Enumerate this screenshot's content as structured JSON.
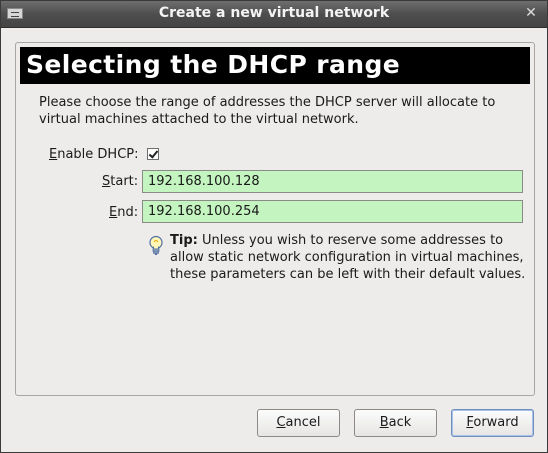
{
  "window": {
    "title": "Create a new virtual network"
  },
  "banner": {
    "title": "Selecting the DHCP range"
  },
  "intro": {
    "text": "Please choose the range of addresses the DHCP server will allocate to virtual machines attached to the virtual network."
  },
  "dhcp": {
    "enable_prefix": "E",
    "enable_rest": "nable DHCP:",
    "enabled": true,
    "start_prefix": "S",
    "start_rest": "tart:",
    "start_value": "192.168.100.128",
    "end_prefix": "E",
    "end_rest": "nd:",
    "end_value": "192.168.100.254"
  },
  "tip": {
    "label": "Tip:",
    "text": " Unless you wish to reserve some addresses to allow static network configuration in virtual machines, these parameters can be left with their default values."
  },
  "buttons": {
    "cancel_prefix": "C",
    "cancel_rest": "ancel",
    "back_prefix": "B",
    "back_rest": "ack",
    "forward_prefix": "F",
    "forward_rest": "orward"
  },
  "icons": {
    "app": "network-icon",
    "close": "close-icon",
    "tip": "lightbulb-icon"
  },
  "colors": {
    "field_bg": "#c4f5c0",
    "banner_bg": "#000000",
    "banner_text": "#ffffff"
  }
}
